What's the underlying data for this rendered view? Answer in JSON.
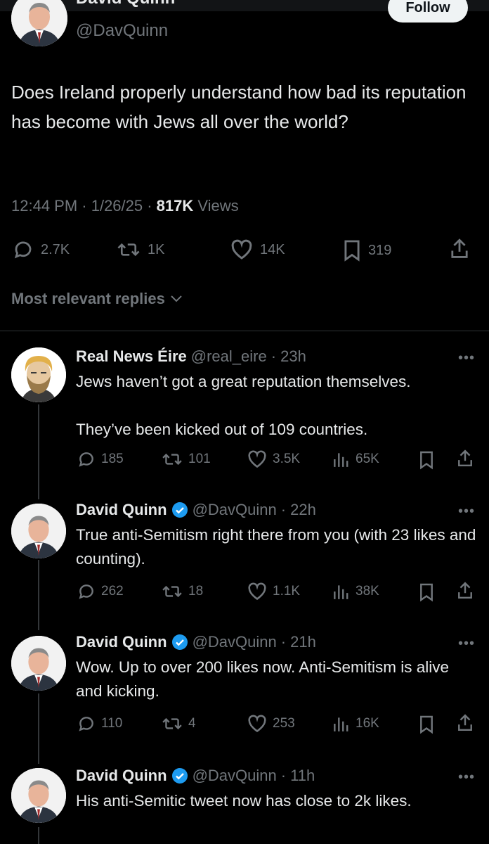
{
  "tweet": {
    "name_cut": "David Quinn",
    "handle": "@DavQuinn",
    "follow_label": "Follow",
    "text": "Does Ireland properly understand how bad its reputation has become with Jews all over the world?",
    "time": "12:44 PM · 1/26/25 · ",
    "views_count": "817K",
    "views_label": " Views",
    "stats": {
      "replies": "2.7K",
      "reposts": "1K",
      "likes": "14K",
      "bookmarks": "319"
    }
  },
  "replies_sort_label": "Most relevant replies",
  "replies": [
    {
      "name": "Real News Éire",
      "verified": false,
      "handle": "@real_eire",
      "time": "· 23h",
      "text": "Jews haven’t got a great reputation themselves.\n\nThey’ve been kicked out of 109 countries.",
      "replies": "185",
      "reposts": "101",
      "likes": "3.5K",
      "views": "65K"
    },
    {
      "name": "David Quinn",
      "verified": true,
      "handle": "@DavQuinn",
      "time": "· 22h",
      "text": "True anti-Semitism right there from you (with 23 likes and counting).",
      "replies": "262",
      "reposts": "18",
      "likes": "1.1K",
      "views": "38K"
    },
    {
      "name": "David Quinn",
      "verified": true,
      "handle": "@DavQuinn",
      "time": "· 21h",
      "text": "Wow. Up to over 200 likes now. Anti-Semitism is alive and kicking.",
      "replies": "110",
      "reposts": "4",
      "likes": "253",
      "views": "16K"
    },
    {
      "name": "David Quinn",
      "verified": true,
      "handle": "@DavQuinn",
      "time": "· 11h",
      "text": "His anti-Semitic tweet now has close to 2k likes."
    }
  ],
  "colors": {
    "background": "#000000",
    "text": "#e7e9ea",
    "muted": "#71767b",
    "verified_blue": "#1d9bf0"
  }
}
